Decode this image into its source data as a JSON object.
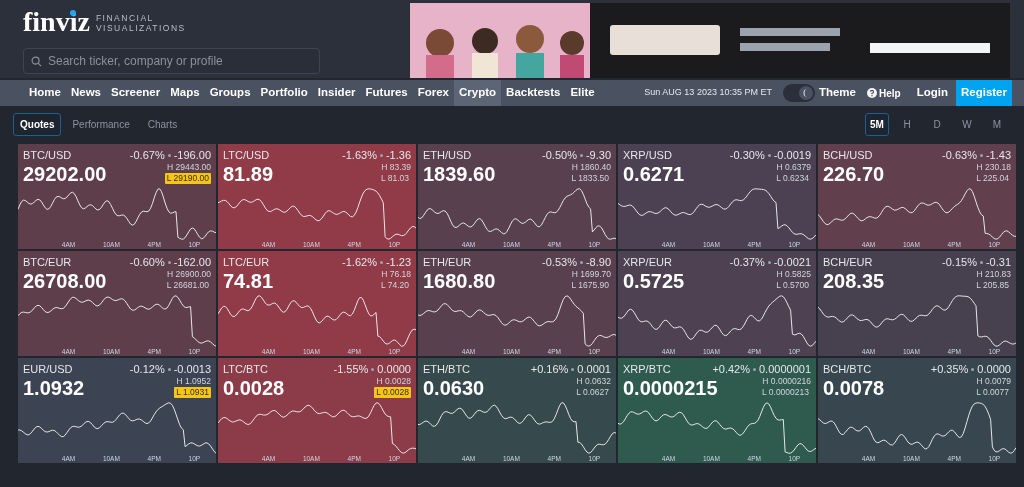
{
  "logo": {
    "name": "finviz",
    "tagline": [
      "FINANCIAL",
      "VISUALIZATIONS"
    ]
  },
  "search": {
    "placeholder": "Search ticker, company or profile"
  },
  "nav": [
    {
      "label": "Home",
      "selected": false
    },
    {
      "label": "News",
      "selected": false
    },
    {
      "label": "Screener",
      "selected": false
    },
    {
      "label": "Maps",
      "selected": false
    },
    {
      "label": "Groups",
      "selected": false
    },
    {
      "label": "Portfolio",
      "selected": false
    },
    {
      "label": "Insider",
      "selected": false
    },
    {
      "label": "Futures",
      "selected": false
    },
    {
      "label": "Forex",
      "selected": false
    },
    {
      "label": "Crypto",
      "selected": true
    },
    {
      "label": "Backtests",
      "selected": false
    },
    {
      "label": "Elite",
      "selected": false
    }
  ],
  "datetime": "Sun AUG 13 2023 10:35 PM ET",
  "theme": {
    "label": "Theme",
    "on": true
  },
  "help": "Help",
  "login": "Login",
  "register": "Register",
  "views": [
    {
      "label": "Quotes",
      "selected": true
    },
    {
      "label": "Performance",
      "selected": false
    },
    {
      "label": "Charts",
      "selected": false
    }
  ],
  "timeframes": [
    {
      "label": "5M",
      "selected": true
    },
    {
      "label": "H",
      "selected": false
    },
    {
      "label": "D",
      "selected": false
    },
    {
      "label": "W",
      "selected": false
    },
    {
      "label": "M",
      "selected": false
    }
  ],
  "cards": [
    {
      "symbol": "BTC/USD",
      "change_pct": "-0.67%",
      "change": "-196.00",
      "price": "29202.00",
      "high": "H 29443.00",
      "low": "L 29190.00",
      "low_highlighted": true,
      "color": "#5f3e4c",
      "xticks": [
        "4AM",
        "10AM",
        "4PM",
        "10P"
      ]
    },
    {
      "symbol": "LTC/USD",
      "change_pct": "-1.63%",
      "change": "-1.36",
      "price": "81.89",
      "high": "H 83.39",
      "low": "L 81.03",
      "low_highlighted": false,
      "color": "#903b47",
      "xticks": [
        "4AM",
        "10AM",
        "4PM",
        "10P"
      ]
    },
    {
      "symbol": "ETH/USD",
      "change_pct": "-0.50%",
      "change": "-9.30",
      "price": "1839.60",
      "high": "H 1860.40",
      "low": "L 1833.50",
      "low_highlighted": false,
      "color": "#58404f",
      "xticks": [
        "4AM",
        "10AM",
        "4PM",
        "10P"
      ]
    },
    {
      "symbol": "XRP/USD",
      "change_pct": "-0.30%",
      "change": "-0.0019",
      "price": "0.6271",
      "high": "H 0.6379",
      "low": "L 0.6234",
      "low_highlighted": false,
      "color": "#4b4152",
      "xticks": [
        "4AM",
        "10AM",
        "4PM",
        "10P"
      ]
    },
    {
      "symbol": "BCH/USD",
      "change_pct": "-0.63%",
      "change": "-1.43",
      "price": "226.70",
      "high": "H 230.18",
      "low": "L 225.04",
      "low_highlighted": false,
      "color": "#613f4d",
      "xticks": [
        "4AM",
        "10AM",
        "4PM",
        "10P"
      ]
    },
    {
      "symbol": "BTC/EUR",
      "change_pct": "-0.60%",
      "change": "-162.00",
      "price": "26708.00",
      "high": "H 26900.00",
      "low": "L 26681.00",
      "low_highlighted": false,
      "color": "#5f3e4c",
      "xticks": [
        "4AM",
        "10AM",
        "4PM",
        "10P"
      ]
    },
    {
      "symbol": "LTC/EUR",
      "change_pct": "-1.62%",
      "change": "-1.23",
      "price": "74.81",
      "high": "H 76.18",
      "low": "L 74.20",
      "low_highlighted": false,
      "color": "#903b47",
      "xticks": [
        "4AM",
        "10AM",
        "4PM",
        "10P"
      ]
    },
    {
      "symbol": "ETH/EUR",
      "change_pct": "-0.53%",
      "change": "-8.90",
      "price": "1680.80",
      "high": "H 1699.70",
      "low": "L 1675.90",
      "low_highlighted": false,
      "color": "#58404f",
      "xticks": [
        "4AM",
        "10AM",
        "4PM",
        "10P"
      ]
    },
    {
      "symbol": "XRP/EUR",
      "change_pct": "-0.37%",
      "change": "-0.0021",
      "price": "0.5725",
      "high": "H 0.5825",
      "low": "L 0.5700",
      "low_highlighted": false,
      "color": "#4d4152",
      "xticks": [
        "4AM",
        "10AM",
        "4PM",
        "10P"
      ]
    },
    {
      "symbol": "BCH/EUR",
      "change_pct": "-0.15%",
      "change": "-0.31",
      "price": "208.35",
      "high": "H 210.83",
      "low": "L 205.85",
      "low_highlighted": false,
      "color": "#46404f",
      "xticks": [
        "4AM",
        "10AM",
        "4PM",
        "10P"
      ]
    },
    {
      "symbol": "EUR/USD",
      "change_pct": "-0.12%",
      "change": "-0.0013",
      "price": "1.0932",
      "high": "H 1.0952",
      "low": "L 1.0931",
      "low_highlighted": true,
      "color": "#3c4353",
      "xticks": [
        "4AM",
        "10AM",
        "4PM",
        "10P"
      ]
    },
    {
      "symbol": "LTC/BTC",
      "change_pct": "-1.55%",
      "change": "0.0000",
      "price": "0.0028",
      "high": "H 0.0028",
      "low": "L 0.0028",
      "low_highlighted": true,
      "color": "#8c3c48",
      "xticks": [
        "4AM",
        "10AM",
        "4PM",
        "10P"
      ]
    },
    {
      "symbol": "ETH/BTC",
      "change_pct": "+0.16%",
      "change": "0.0001",
      "price": "0.0630",
      "high": "H 0.0632",
      "low": "L 0.0627",
      "low_highlighted": false,
      "color": "#364a4d",
      "xticks": [
        "4AM",
        "10AM",
        "4PM",
        "10P"
      ]
    },
    {
      "symbol": "XRP/BTC",
      "change_pct": "+0.42%",
      "change": "0.0000001",
      "price": "0.0000215",
      "high": "H 0.0000216",
      "low": "L 0.0000213",
      "low_highlighted": false,
      "color": "#2f5a4e",
      "xticks": [
        "4AM",
        "10AM",
        "4PM",
        "10P"
      ]
    },
    {
      "symbol": "BCH/BTC",
      "change_pct": "+0.35%",
      "change": "0.0000",
      "price": "0.0078",
      "high": "H 0.0079",
      "low": "L 0.0077",
      "low_highlighted": false,
      "color": "#38474f",
      "xticks": [
        "4AM",
        "10AM",
        "4PM",
        "10P"
      ]
    }
  ]
}
